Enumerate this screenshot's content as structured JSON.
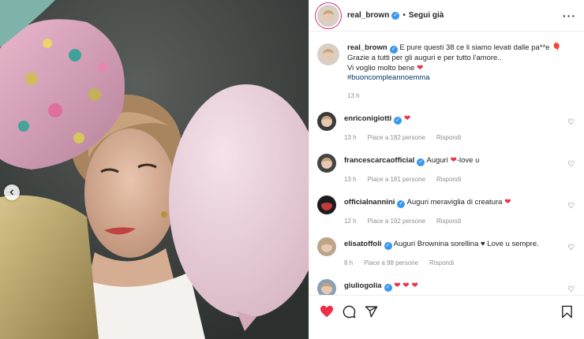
{
  "post": {
    "username": "real_brown",
    "separator": "•",
    "follow_label": "Segui già",
    "more_label": "···",
    "caption": {
      "line1": "E pure questi 38 ce li siamo levati dalle pa**e",
      "line2": "Grazie a tutti per gli auguri e per tutto l'amore..",
      "line3": "Vi voglio molto bene",
      "hashtag": "#buoncompleannoemma",
      "time": "13 h"
    },
    "comments": [
      {
        "username": "enriconigiotti",
        "text": "",
        "has_heart": true,
        "time": "13 h",
        "likes": "Piace a 182 persone",
        "reply": "Rispondi"
      },
      {
        "username": "francescarcaofficial",
        "text": "Auguri",
        "after": "-love u",
        "has_heart": true,
        "time": "13 h",
        "likes": "Piace a 181 persone",
        "reply": "Rispondi"
      },
      {
        "username": "officialnannini",
        "text": "Auguri meraviglia di creatura",
        "has_heart": true,
        "time": "12 h",
        "likes": "Piace a 192 persone",
        "reply": "Rispondi"
      },
      {
        "username": "elisatoffoli",
        "text": "Auguri Browni­na sorellina ♥ Love u sempre.",
        "has_heart": false,
        "time": "8 h",
        "likes": "Piace a 98 persone",
        "reply": "Rispondi"
      },
      {
        "username": "giuliogolia",
        "text": "",
        "has_heart": true,
        "hearts": "❤ ❤ ❤"
      }
    ]
  },
  "icons": {
    "verified": "verified-badge-icon",
    "like": "heart-icon",
    "comment": "comment-bubble-icon",
    "share": "paper-plane-icon",
    "save": "bookmark-icon",
    "prev": "chevron-left-icon"
  },
  "colors": {
    "like_red": "#ed2f47",
    "verified_blue": "#3897f0",
    "hashtag": "#00376b"
  }
}
